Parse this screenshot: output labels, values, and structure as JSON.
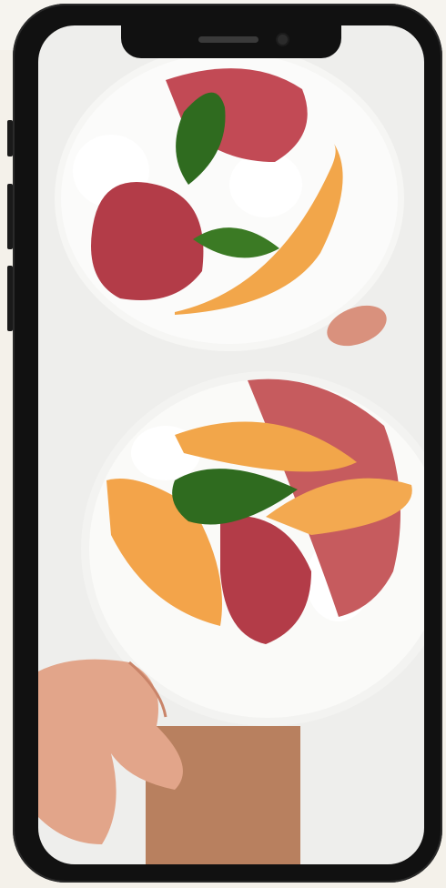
{
  "scene": {
    "subject": "food-photo-on-phone",
    "colors": {
      "background": "#f4f1ea",
      "phone_body": "#111111",
      "melon": "#f4a94c",
      "ham": "#b8454f",
      "basil": "#2f6b1f",
      "plate": "#f3f3f1"
    }
  }
}
